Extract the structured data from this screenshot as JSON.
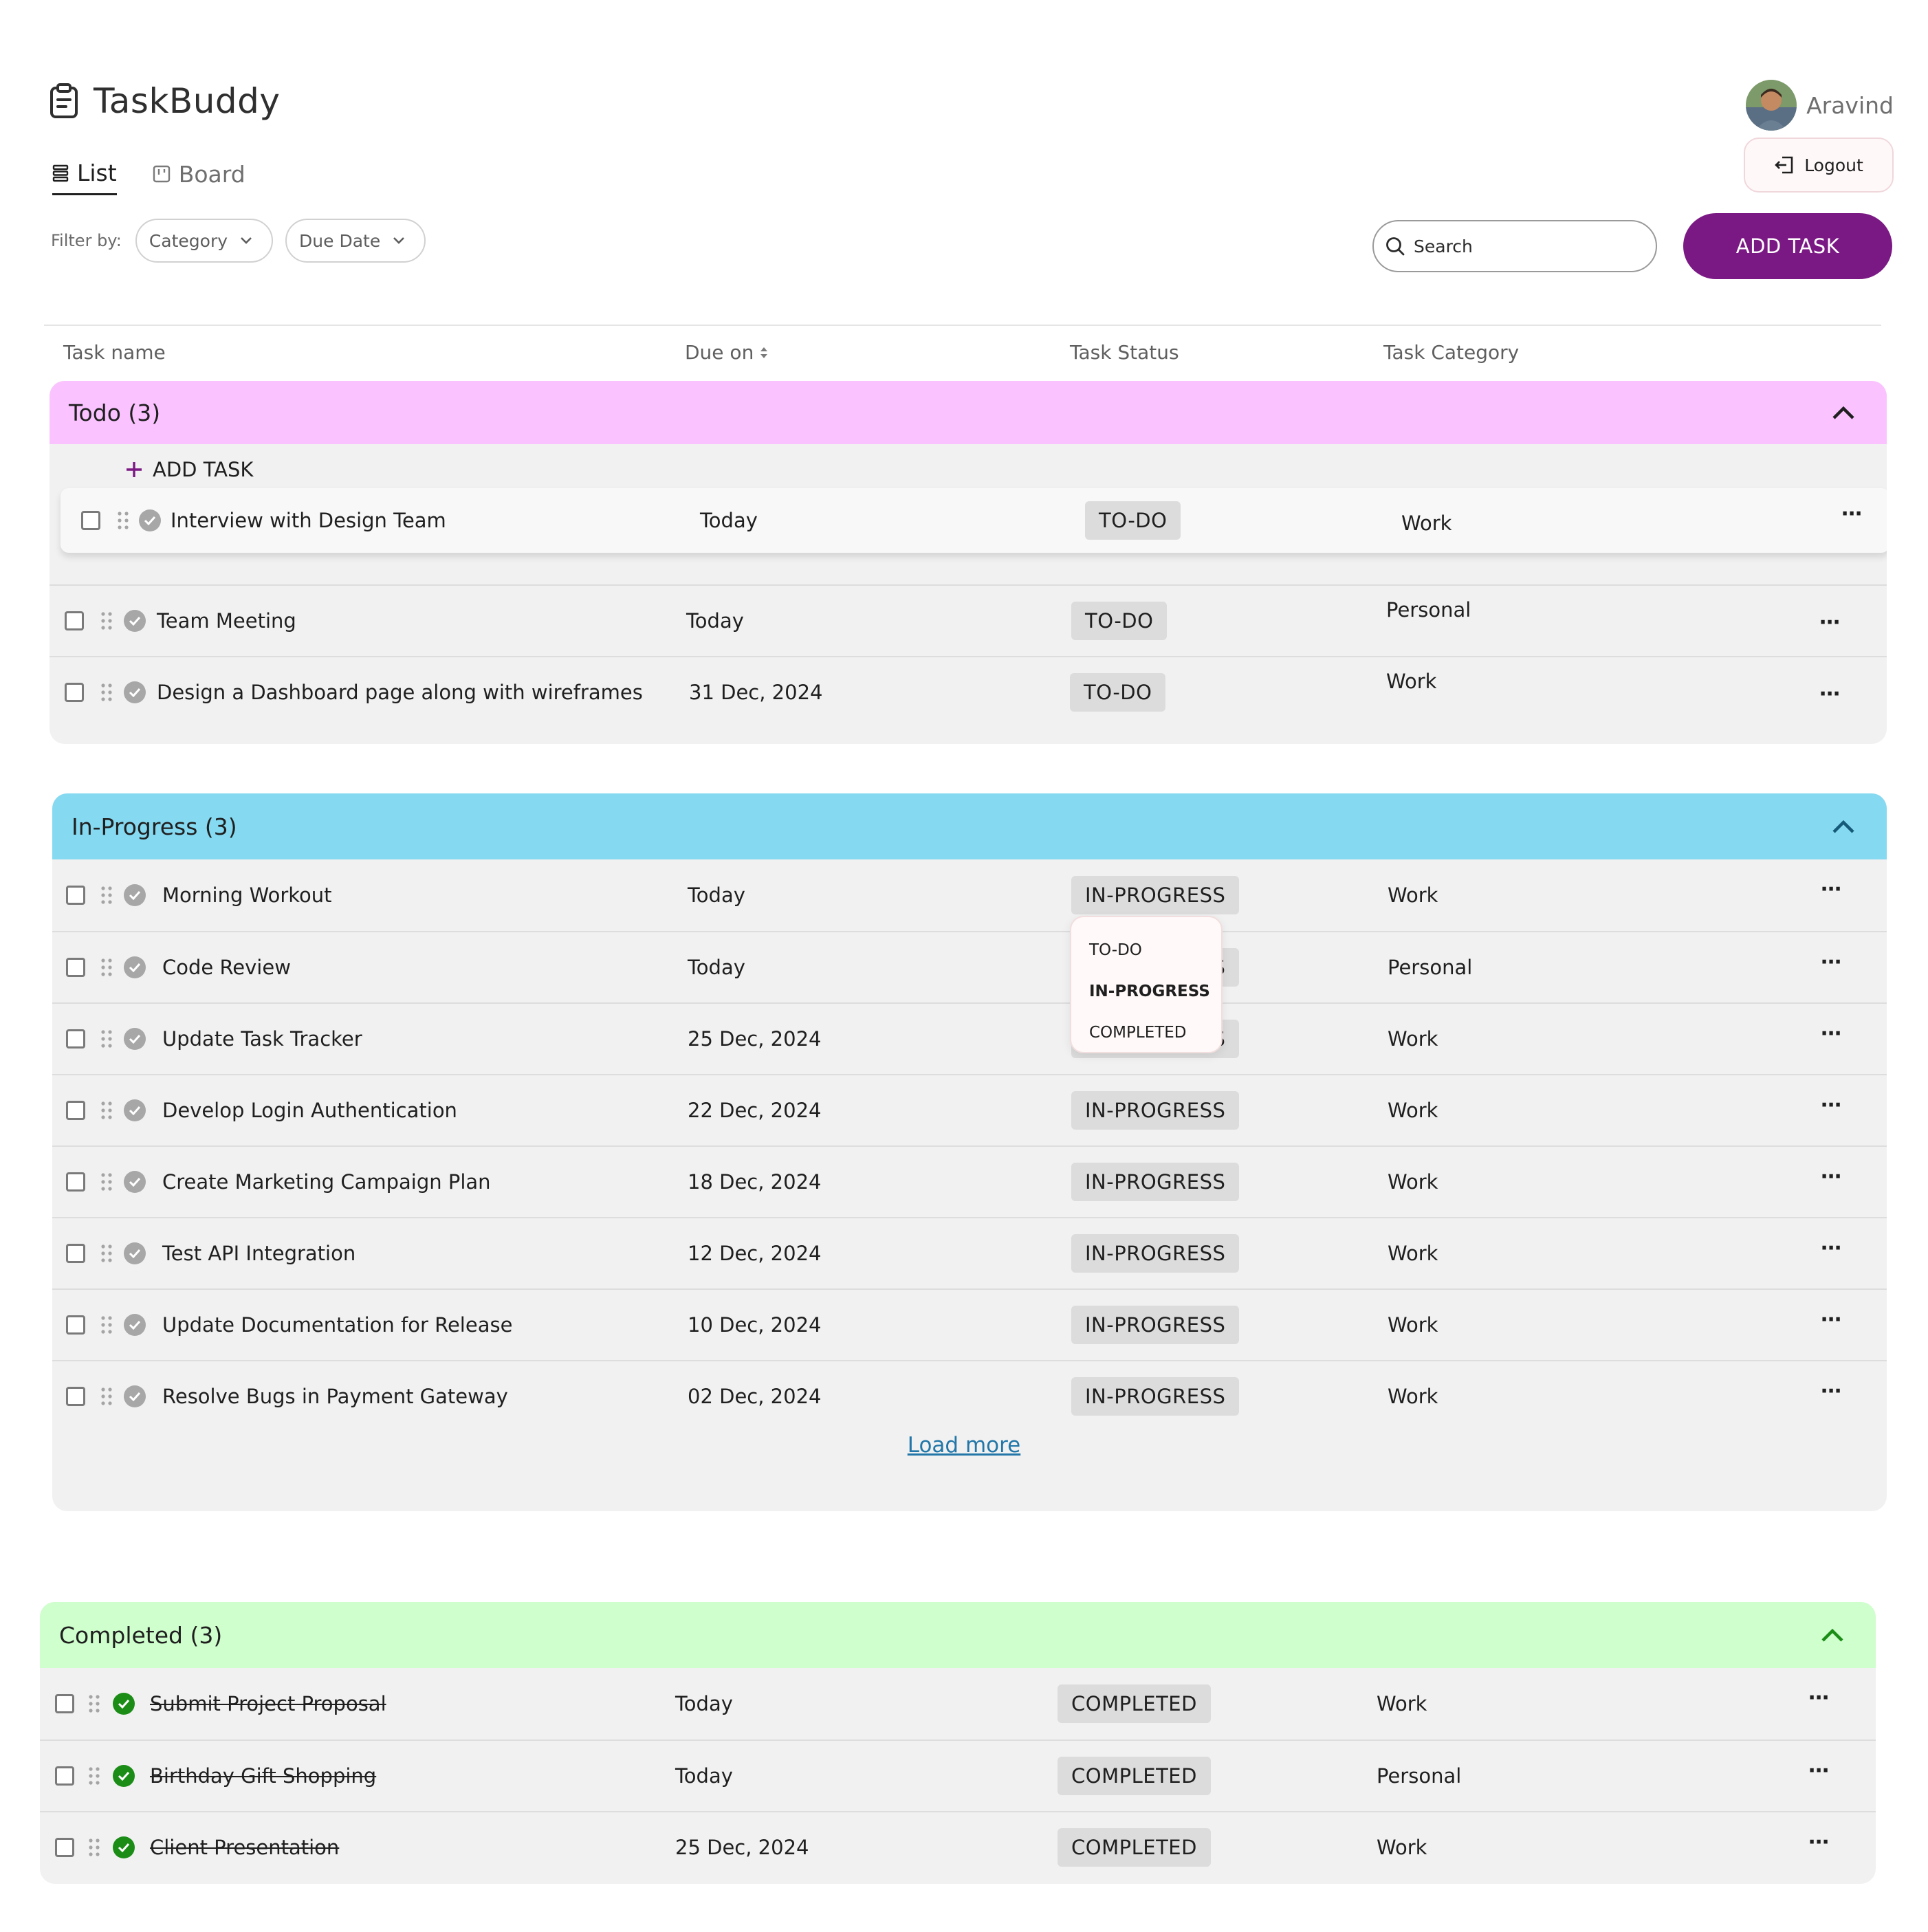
{
  "app": {
    "title": "TaskBuddy"
  },
  "views": {
    "list": "List",
    "board": "Board"
  },
  "filters": {
    "label": "Filter by:",
    "category": "Category",
    "due_date": "Due Date"
  },
  "user": {
    "name": "Aravind",
    "logout": "Logout"
  },
  "search": {
    "placeholder": "Search"
  },
  "add_task_button": "ADD TASK",
  "columns": {
    "name": "Task name",
    "due": "Due on",
    "status": "Task Status",
    "category": "Task Category"
  },
  "sections": {
    "todo": {
      "title": "Todo (3)",
      "add_label": "ADD TASK",
      "tasks": [
        {
          "name": "Interview with Design Team",
          "due": "Today",
          "status": "TO-DO",
          "category": "Work"
        },
        {
          "name": "Team Meeting",
          "due": "Today",
          "status": "TO-DO",
          "category": "Personal"
        },
        {
          "name": "Design a Dashboard page along with wireframes",
          "due": "31 Dec, 2024",
          "status": "TO-DO",
          "category": "Work"
        }
      ]
    },
    "inprogress": {
      "title": "In-Progress (3)",
      "load_more": "Load more",
      "tasks": [
        {
          "name": "Morning Workout",
          "due": "Today",
          "status": "IN-PROGRESS",
          "category": "Work"
        },
        {
          "name": "Code Review",
          "due": "Today",
          "status": "IN-PROGRESS",
          "category": "Personal"
        },
        {
          "name": "Update Task Tracker",
          "due": "25 Dec, 2024",
          "status": "IN-PROGRESS",
          "category": "Work"
        },
        {
          "name": "Develop Login Authentication",
          "due": "22 Dec, 2024",
          "status": "IN-PROGRESS",
          "category": "Work"
        },
        {
          "name": "Create Marketing Campaign Plan",
          "due": "18 Dec, 2024",
          "status": "IN-PROGRESS",
          "category": "Work"
        },
        {
          "name": "Test API Integration",
          "due": "12 Dec, 2024",
          "status": "IN-PROGRESS",
          "category": "Work"
        },
        {
          "name": "Update Documentation for Release",
          "due": "10 Dec, 2024",
          "status": "IN-PROGRESS",
          "category": "Work"
        },
        {
          "name": "Resolve Bugs in Payment Gateway",
          "due": "02 Dec, 2024",
          "status": "IN-PROGRESS",
          "category": "Work"
        }
      ]
    },
    "completed": {
      "title": "Completed (3)",
      "tasks": [
        {
          "name": "Submit Project Proposal",
          "due": "Today",
          "status": "COMPLETED",
          "category": "Work"
        },
        {
          "name": "Birthday Gift Shopping",
          "due": "Today",
          "status": "COMPLETED",
          "category": "Personal"
        },
        {
          "name": "Client Presentation",
          "due": "25 Dec, 2024",
          "status": "COMPLETED",
          "category": "Work"
        }
      ]
    }
  },
  "status_menu": {
    "options": [
      "TO-DO",
      "IN-PROGRESS",
      "COMPLETED"
    ],
    "selected": "IN-PROGRESS"
  },
  "more_icon": "⋯",
  "colors": {
    "accent": "#7b1984",
    "todo_header": "#fac3ff",
    "inprogress_header": "#85d9f1",
    "completed_header": "#ceffcc",
    "completed_check": "#1b8d17",
    "link": "#2277a8"
  },
  "icons": [
    "clipboard-icon",
    "list-icon",
    "board-icon",
    "chevron-down-icon",
    "logout-icon",
    "search-icon",
    "sort-icon",
    "chevron-up-icon",
    "plus-icon",
    "drag-handle-icon",
    "check-circle-icon",
    "more-icon"
  ]
}
